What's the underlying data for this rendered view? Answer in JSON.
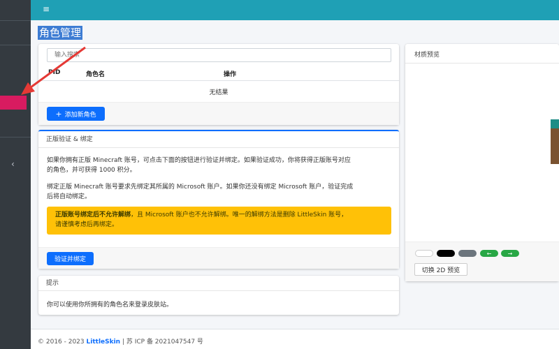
{
  "page": {
    "title": "角色管理"
  },
  "colors": {
    "sidebar": "#343a40",
    "topbar": "#1fa0b5",
    "active_menu": "#d81b60",
    "primary": "#0d6efd",
    "warning": "#ffc107",
    "annotation_arrow": "#e53935"
  },
  "topbar": {
    "menu_icon": "≡"
  },
  "sidebar": {
    "collapse_icon": "‹"
  },
  "players": {
    "search_placeholder": "输入搜索",
    "columns": [
      "PID",
      "角色名",
      "操作"
    ],
    "empty": "无结果",
    "add_button": "添加新角色"
  },
  "verify": {
    "title": "正版验证 & 绑定",
    "para1_line1": "如果你拥有正版 Minecraft 账号，可点击下面的按钮进行验证并绑定。如果验证成功，你将获得正版账号对应",
    "para1_line2": "的角色，并可获得 1000 积分。",
    "para2_line1": "绑定正版 Minecraft 账号要求先绑定其所属的 Microsoft 账户。如果你还没有绑定 Microsoft 账户，验证完成",
    "para2_line2": "后将自动绑定。",
    "alert_bold": "正版账号绑定后不允许解绑",
    "alert_line1_rest": "，且 Microsoft 账户也不允许解绑。唯一的解绑方法是删除 LittleSkin 账号，",
    "alert_line2": "请谨慎考虑后再绑定。",
    "button": "验证并绑定"
  },
  "tips": {
    "title": "提示",
    "text": "你可以使用你所拥有的角色名来登录皮肤站。"
  },
  "preview": {
    "title": "材质预览",
    "swatches": [
      "#ffffff",
      "#000000",
      "#6c757d"
    ],
    "nav_color": "#28a745",
    "prev_icon": "←",
    "next_icon": "→",
    "toggle_button": "切换 2D 预览"
  },
  "footer": {
    "copyright": "© 2016 - 2023",
    "brand": "LittleSkin",
    "icp": "| 苏 ICP 备 2021047547 号"
  }
}
